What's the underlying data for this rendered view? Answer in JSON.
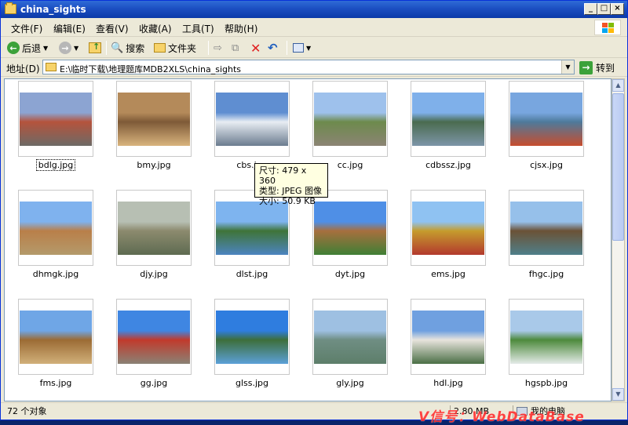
{
  "window": {
    "title": "china_sights",
    "buttons": {
      "minimize": "_",
      "maximize": "□",
      "close": "×"
    }
  },
  "menu": [
    "文件(F)",
    "编辑(E)",
    "查看(V)",
    "收藏(A)",
    "工具(T)",
    "帮助(H)"
  ],
  "toolbar": {
    "back_label": "后退",
    "search_label": "搜索",
    "folders_label": "文件夹"
  },
  "address": {
    "label": "地址(D)",
    "path": "E:\\临时下载\\地理题库MDB2XLS\\china_sights",
    "go_label": "转到"
  },
  "tooltip": {
    "line1": "尺寸: 479 x 360",
    "line2": "类型: JPEG 图像",
    "line3": "大小: 50.9 KB"
  },
  "files": [
    {
      "name": "bdlg.jpg",
      "colors": [
        "#8ca4d2",
        "#b5533c",
        "#6d6a66"
      ]
    },
    {
      "name": "bmy.jpg",
      "colors": [
        "#b48a5a",
        "#7e5a37",
        "#d9b47e"
      ]
    },
    {
      "name": "cbs.jpg",
      "colors": [
        "#5f8ed1",
        "#e8edf3",
        "#6b7c8f"
      ]
    },
    {
      "name": "cc.jpg",
      "colors": [
        "#9ec1ec",
        "#6d8a4c",
        "#8b8474"
      ]
    },
    {
      "name": "cdbssz.jpg",
      "colors": [
        "#7fb0ea",
        "#4a6b4f",
        "#7d95a8"
      ]
    },
    {
      "name": "cjsx.jpg",
      "colors": [
        "#78a6df",
        "#4e7a9b",
        "#c74d2e"
      ]
    },
    {
      "name": "dhmgk.jpg",
      "colors": [
        "#7fb2ee",
        "#b97f49",
        "#b49a6b"
      ]
    },
    {
      "name": "djy.jpg",
      "colors": [
        "#b7bfb3",
        "#8c8a6e",
        "#5e6b51"
      ]
    },
    {
      "name": "dlst.jpg",
      "colors": [
        "#7eb4ef",
        "#3f7438",
        "#4c84c0"
      ]
    },
    {
      "name": "dyt.jpg",
      "colors": [
        "#4f8fe6",
        "#a76f3e",
        "#3f7f35"
      ]
    },
    {
      "name": "ems.jpg",
      "colors": [
        "#8fc2f2",
        "#c59c2d",
        "#b3392d"
      ]
    },
    {
      "name": "fhgc.jpg",
      "colors": [
        "#96c0ea",
        "#6b5236",
        "#4f7f8a"
      ]
    },
    {
      "name": "fms.jpg",
      "colors": [
        "#6fa6e6",
        "#9b6b34",
        "#d1b07a"
      ]
    },
    {
      "name": "gg.jpg",
      "colors": [
        "#3f86e2",
        "#c13a2c",
        "#8a8275"
      ]
    },
    {
      "name": "glss.jpg",
      "colors": [
        "#2f7ddf",
        "#3d6e3a",
        "#5ba0d8"
      ]
    },
    {
      "name": "gly.jpg",
      "colors": [
        "#9ec0e2",
        "#6f8e83",
        "#5d7e6a"
      ]
    },
    {
      "name": "hdl.jpg",
      "colors": [
        "#6fa0e0",
        "#e8e4dd",
        "#4b6f46"
      ]
    },
    {
      "name": "hgspb.jpg",
      "colors": [
        "#a9c9e9",
        "#4d8a3c",
        "#e4ebe8"
      ]
    }
  ],
  "status": {
    "count": "72 个对象",
    "size": "2.80 MB",
    "location": "我的电脑",
    "watermark": "V信号：WebDataBase"
  }
}
